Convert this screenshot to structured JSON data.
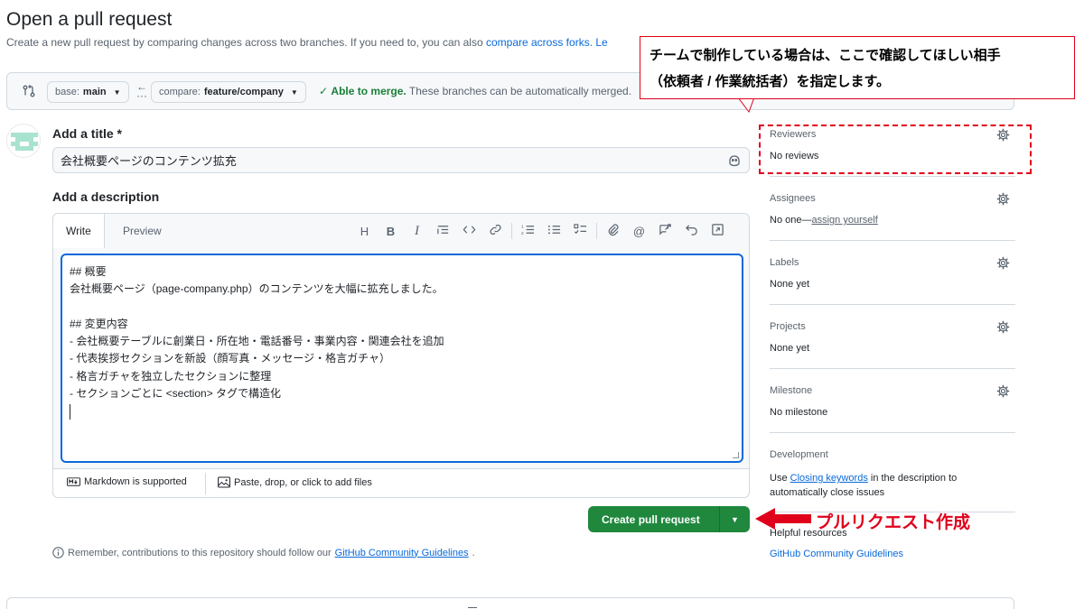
{
  "page": {
    "title": "Open a pull request",
    "subtitle_text": "Create a new pull request by comparing changes across two branches. If you need to, you can also ",
    "subtitle_link": "compare across forks",
    "subtitle_after": ". ",
    "subtitle_tail": "Le"
  },
  "compare_bar": {
    "base_key": "base:",
    "base_value": "main",
    "compare_key": "compare:",
    "compare_value": "feature/company",
    "merge_status": "Able to merge.",
    "merge_detail": "These branches can be automatically merged."
  },
  "form": {
    "title_label": "Add a title *",
    "title_value": "会社概要ページのコンテンツ拡充",
    "description_label": "Add a description",
    "tabs": [
      "Write",
      "Preview"
    ],
    "toolbar_icons": [
      "heading-icon",
      "bold-icon",
      "italic-icon",
      "quote-icon",
      "code-icon",
      "link-icon",
      "ordered-list-icon",
      "unordered-list-icon",
      "task-list-icon",
      "attach-icon",
      "mention-icon",
      "reference-icon",
      "undo-icon",
      "fullscreen-icon"
    ],
    "description_lines": [
      "## 概要",
      "会社概要ページ（page-company.php）のコンテンツを大幅に拡充しました。",
      "",
      "## 変更内容",
      "- 会社概要テーブルに創業日・所在地・電話番号・事業内容・関連会社を追加",
      "- 代表挨拶セクションを新設（顔写真・メッセージ・格言ガチャ）",
      "- 格言ガチャを独立したセクションに整理",
      "- セクションごとに <section> タグで構造化"
    ],
    "markdown_note": "Markdown is supported",
    "attach_note": "Paste, drop, or click to add files",
    "create_button": "Create pull request",
    "remember_text": "Remember, contributions to this repository should follow our ",
    "remember_link": "GitHub Community Guidelines",
    "remember_end": "."
  },
  "sidebar": {
    "reviewers": {
      "title": "Reviewers",
      "value": "No reviews"
    },
    "assignees": {
      "title": "Assignees",
      "value": "No one—",
      "link": "assign yourself"
    },
    "labels": {
      "title": "Labels",
      "value": "None yet"
    },
    "projects": {
      "title": "Projects",
      "value": "None yet"
    },
    "milestone": {
      "title": "Milestone",
      "value": "No milestone"
    },
    "development": {
      "title": "Development",
      "text_before": "Use ",
      "link": "Closing keywords",
      "text_after": " in the description to automatically close issues"
    },
    "helpful": {
      "title": "Helpful resources",
      "link": "GitHub Community Guidelines"
    }
  },
  "annotations": {
    "callout_line1": "チームで制作している場合は、ここで確認してほしい相手",
    "callout_line2": "（依頼者 / 作業統括者）を指定します。",
    "arrow_label": "プルリクエスト作成",
    "annotation_color": "#e0001b"
  },
  "colors": {
    "accent": "#0969da",
    "success": "#1f883d",
    "border": "#d1d9e0",
    "muted": "#59636e"
  }
}
